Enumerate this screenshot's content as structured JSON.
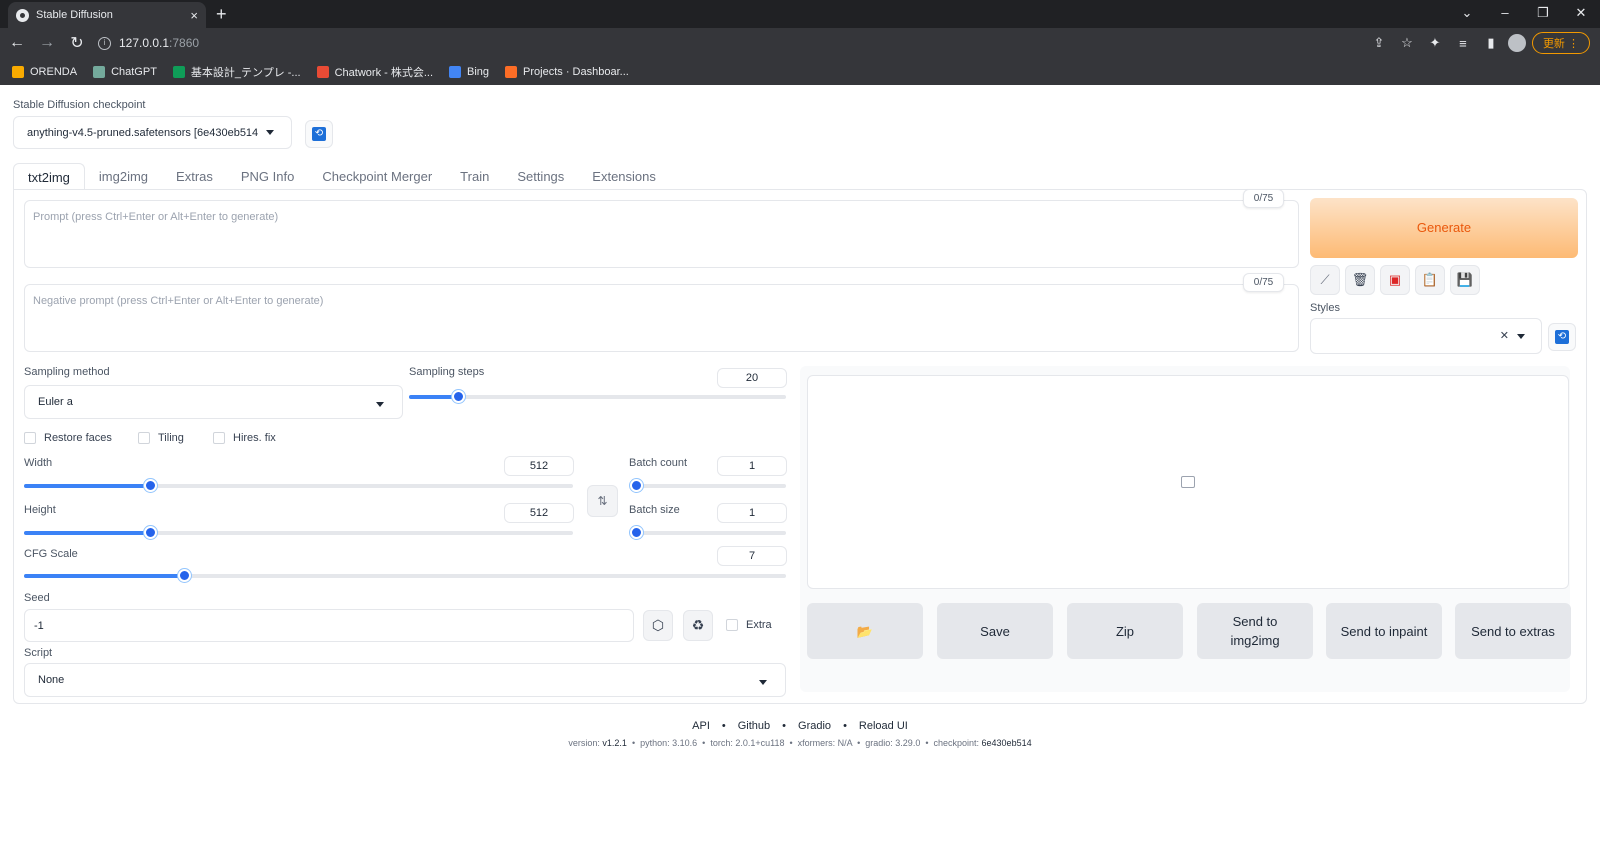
{
  "browser": {
    "tab_title": "Stable Diffusion",
    "url_host": "127.0.0.1",
    "url_port": ":7860",
    "update_label": "更新",
    "bookmarks": [
      {
        "label": "ORENDA",
        "color": "#f9ab00"
      },
      {
        "label": "ChatGPT",
        "color": "#74aa9c"
      },
      {
        "label": "基本設計_テンプレ -...",
        "color": "#0f9d58"
      },
      {
        "label": "Chatwork - 株式会...",
        "color": "#e94b35"
      },
      {
        "label": "Bing",
        "color": "#4285f4"
      },
      {
        "label": "Projects · Dashboar...",
        "color": "#fc6d26"
      }
    ]
  },
  "checkpoint": {
    "label": "Stable Diffusion checkpoint",
    "value": "anything-v4.5-pruned.safetensors [6e430eb514"
  },
  "tabs": [
    "txt2img",
    "img2img",
    "Extras",
    "PNG Info",
    "Checkpoint Merger",
    "Train",
    "Settings",
    "Extensions"
  ],
  "prompt": {
    "placeholder": "Prompt (press Ctrl+Enter or Alt+Enter to generate)",
    "counter": "0/75"
  },
  "negative_prompt": {
    "placeholder": "Negative prompt (press Ctrl+Enter or Alt+Enter to generate)",
    "counter": "0/75"
  },
  "generate_label": "Generate",
  "styles_label": "Styles",
  "sampling": {
    "method_label": "Sampling method",
    "method_value": "Euler a",
    "steps_label": "Sampling steps",
    "steps_value": "20",
    "steps_fraction": 0.13
  },
  "checkboxes": {
    "restore_faces": "Restore faces",
    "tiling": "Tiling",
    "hires_fix": "Hires. fix"
  },
  "width": {
    "label": "Width",
    "value": "512",
    "fraction": 0.23
  },
  "height": {
    "label": "Height",
    "value": "512",
    "fraction": 0.23
  },
  "batch_count": {
    "label": "Batch count",
    "value": "1",
    "fraction": 0.0
  },
  "batch_size": {
    "label": "Batch size",
    "value": "1",
    "fraction": 0.0
  },
  "cfg": {
    "label": "CFG Scale",
    "value": "7",
    "fraction": 0.21
  },
  "seed": {
    "label": "Seed",
    "value": "-1",
    "extra_label": "Extra"
  },
  "script": {
    "label": "Script",
    "value": "None"
  },
  "output_buttons": {
    "save": "Save",
    "zip": "Zip",
    "send_img2img": "Send to img2img",
    "send_inpaint": "Send to inpaint",
    "send_extras": "Send to extras"
  },
  "footer": {
    "links": [
      "API",
      "Github",
      "Gradio",
      "Reload UI"
    ],
    "version_label": "version:",
    "version": "v1.2.1",
    "python": "python: 3.10.6",
    "torch": "torch: 2.0.1+cu118",
    "xformers": "xformers: N/A",
    "gradio": "gradio: 3.29.0",
    "checkpoint_label": "checkpoint:",
    "checkpoint": "6e430eb514"
  },
  "colors": {
    "accent": "#2563eb",
    "generate_text": "#ea580c"
  }
}
